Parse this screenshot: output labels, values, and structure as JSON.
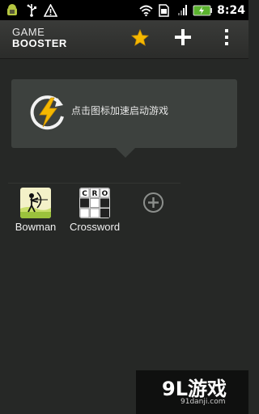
{
  "status_bar": {
    "time": "8:24",
    "icons": [
      "android-debug-icon",
      "usb-icon",
      "warning-icon",
      "wifi-icon",
      "sim-icon",
      "signal-icon",
      "battery-icon"
    ]
  },
  "header": {
    "title_line1": "GAME",
    "title_line2": "BOOSTER",
    "actions": [
      "favorite-star-icon",
      "add-icon",
      "overflow-menu-icon"
    ]
  },
  "tooltip": {
    "text": "点击图标加速启动游戏",
    "icon": "lightning-boost-icon"
  },
  "games": [
    {
      "label": "Bowman",
      "icon": "bowman-game-icon"
    },
    {
      "label": "Crossword",
      "icon": "crossword-game-icon",
      "tiles": [
        "C",
        "R",
        "O"
      ]
    }
  ],
  "add_game_icon": "add-circle-icon",
  "watermark": {
    "main": "9L游戏",
    "sub": "91danji.com"
  },
  "colors": {
    "background": "#262826",
    "bubble": "#3d413e",
    "star": "#f5b800",
    "battery": "#5bb32e"
  }
}
